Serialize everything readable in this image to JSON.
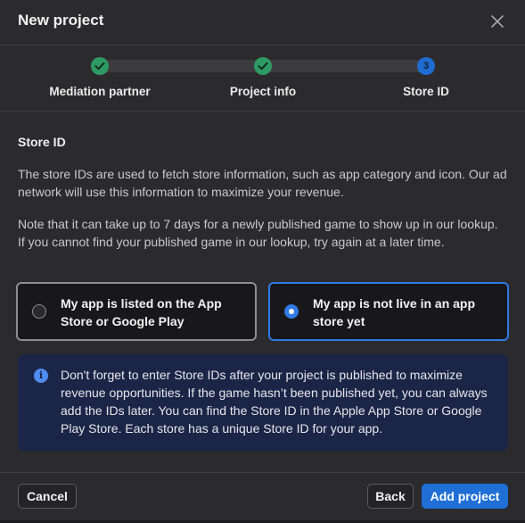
{
  "dialog": {
    "title": "New project",
    "close_icon": "close-icon"
  },
  "stepper": {
    "steps": [
      {
        "label": "Mediation partner",
        "status": "complete",
        "icon": "check-icon"
      },
      {
        "label": "Project info",
        "status": "complete",
        "icon": "check-icon"
      },
      {
        "label": "Store ID",
        "status": "current",
        "number": "3"
      }
    ]
  },
  "content": {
    "section_title": "Store ID",
    "paragraph1": "The store IDs are used to fetch store information, such as app category and icon. Our ad network will use this information to maximize your revenue.",
    "paragraph2": "Note that it can take up to 7 days for a newly published game to show up in our lookup. If you cannot find your published game in our lookup, try again at a later time.",
    "options": [
      {
        "label": "My app is listed on the App Store or Google Play",
        "selected": false
      },
      {
        "label": "My app is not live in an app store yet",
        "selected": true
      }
    ],
    "info": {
      "icon": "info-icon",
      "text": "Don't forget to enter Store IDs after your project is published to maximize revenue opportunities. If the game hasn’t been published yet, you can always add the IDs later. You can find the Store ID in the Apple App Store or Google Play Store. Each store has a unique Store ID for your app."
    }
  },
  "footer": {
    "cancel_label": "Cancel",
    "back_label": "Back",
    "add_label": "Add project"
  },
  "colors": {
    "accent": "#1f6fd6",
    "success": "#2e9a63",
    "info_bg": "#1b2547"
  }
}
